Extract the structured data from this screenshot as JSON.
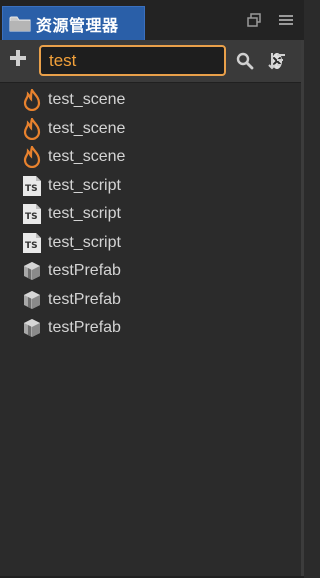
{
  "panel": {
    "title": "资源管理器",
    "tab_icon": "folder-icon",
    "actions": [
      "maximize-icon",
      "menu-icon"
    ]
  },
  "toolbar": {
    "add_icon": "plus-icon",
    "search_value": "test",
    "clear_icon": "clear-icon",
    "search_icon": "search-icon",
    "sort_icon": "sort-icon"
  },
  "assets": [
    {
      "name": "test_scene",
      "type": "scene"
    },
    {
      "name": "test_scene",
      "type": "scene"
    },
    {
      "name": "test_scene",
      "type": "scene"
    },
    {
      "name": "test_script",
      "type": "script"
    },
    {
      "name": "test_script",
      "type": "script"
    },
    {
      "name": "test_script",
      "type": "script"
    },
    {
      "name": "testPrefab",
      "type": "prefab"
    },
    {
      "name": "testPrefab",
      "type": "prefab"
    },
    {
      "name": "testPrefab",
      "type": "prefab"
    }
  ],
  "colors": {
    "tab_active": "#2a5fa8",
    "search_border": "#e9a04a",
    "search_text": "#f2a13b",
    "scene_icon": "#e8822e"
  }
}
